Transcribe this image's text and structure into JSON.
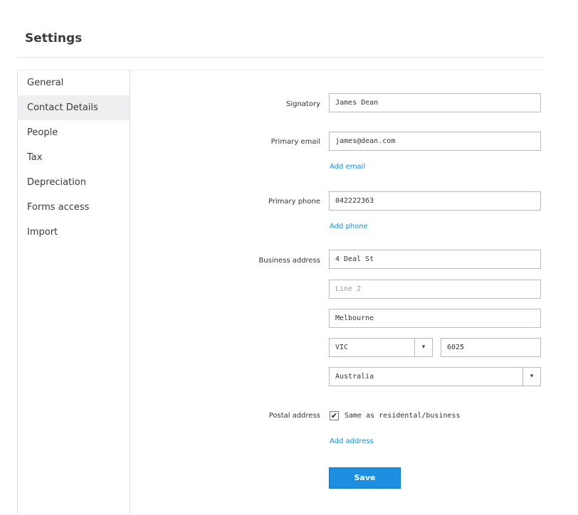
{
  "page_title": "Settings",
  "sidebar": {
    "items": [
      {
        "label": "General"
      },
      {
        "label": "Contact Details",
        "active": true
      },
      {
        "label": "People"
      },
      {
        "label": "Tax"
      },
      {
        "label": "Depreciation"
      },
      {
        "label": "Forms access"
      },
      {
        "label": "Import"
      }
    ]
  },
  "form": {
    "signatory": {
      "label": "Signatory",
      "value": "James Dean"
    },
    "primary_email": {
      "label": "Primary email",
      "value": "james@dean.com",
      "add_link": "Add email"
    },
    "primary_phone": {
      "label": "Primary phone",
      "value": "042222363",
      "add_link": "Add phone"
    },
    "business_address": {
      "label": "Business address",
      "line1": "4 Deal St",
      "line2_placeholder": "Line 2",
      "city": "Melbourne",
      "state": "VIC",
      "postcode": "6025",
      "country": "Australia"
    },
    "postal_address": {
      "label": "Postal address",
      "checkbox_label": "Same as residental/business",
      "checked": true,
      "add_link": "Add address"
    },
    "save_label": "Save"
  },
  "icons": {
    "dropdown": "chevron-down-icon",
    "check": "check-icon"
  },
  "colors": {
    "accent": "#1c8fe0",
    "link": "#1a8ee0",
    "sidebar_active_bg": "#efeff1"
  }
}
